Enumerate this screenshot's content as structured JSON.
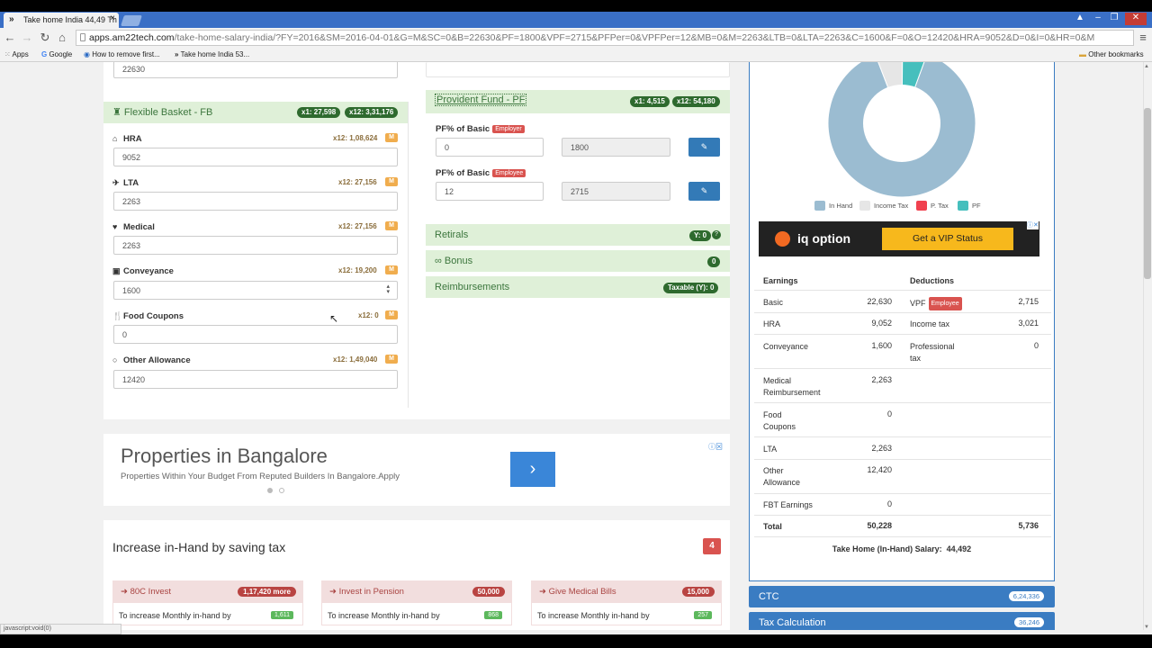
{
  "browser": {
    "tab_title": "Take home India 44,49 Th",
    "url_host": "apps.am22tech.com",
    "url_path": "/take-home-salary-india/?FY=2016&SM=2016-04-01&G=M&SC=0&B=22630&PF=1800&VPF=2715&PFPer=0&VPFPer=12&MB=0&M=2263&LTB=0&LTA=2263&C=1600&F=0&O=12420&HRA=9052&D=0&I=0&HR=0&M",
    "bookmarks": [
      "Apps",
      "Google",
      "How to remove first...",
      "Take home India 53..."
    ],
    "other_bookmarks": "Other bookmarks",
    "status_text": "javascript:void(0)"
  },
  "left_panel": {
    "top_value": "22630",
    "fb_title": "Flexible Basket - FB",
    "fb_x1": "x1: 27,598",
    "fb_x12": "x12: 3,31,176",
    "fields": [
      {
        "label": "HRA",
        "icon": "home-icon",
        "x12": "x12: 1,08,624",
        "value": "9052"
      },
      {
        "label": "LTA",
        "icon": "plane-icon",
        "x12": "x12: 27,156",
        "value": "2263"
      },
      {
        "label": "Medical",
        "icon": "heartbeat-icon",
        "x12": "x12: 27,156",
        "value": "2263"
      },
      {
        "label": "Conveyance",
        "icon": "bus-icon",
        "x12": "x12: 19,200",
        "value": "1600"
      },
      {
        "label": "Food Coupons",
        "icon": "cutlery-icon",
        "x12": "x12: 0",
        "value": "0"
      },
      {
        "label": "Other Allowance",
        "icon": "circle-icon",
        "x12": "x12: 1,49,040",
        "value": "12420"
      }
    ],
    "m_badge": "M"
  },
  "right_panel": {
    "pf_title": "Provident Fund - PF",
    "pf_x1": "x1: 4,515",
    "pf_x12": "x12: 54,180",
    "pf_rows": [
      {
        "label": "PF% of Basic",
        "badge": "Employer",
        "percent": "0",
        "amount": "1800"
      },
      {
        "label": "PF% of Basic",
        "badge": "Employee",
        "percent": "12",
        "amount": "2715"
      }
    ],
    "retirals": "Retirals",
    "retirals_badge": "Y: 0",
    "bonus": "Bonus",
    "bonus_badge": "0",
    "reimbursements": "Reimbursements",
    "reimb_badge": "Taxable (Y): 0"
  },
  "ad": {
    "title": "Properties in Bangalore",
    "subtitle": "Properties Within Your Budget From Reputed Builders In Bangalore.Apply"
  },
  "tax_section": {
    "title": "Increase in-Hand by saving tax",
    "count": "4",
    "tips": [
      {
        "title": "80C Invest",
        "badge": "1,17,420 more",
        "text": "To increase Monthly in-hand by",
        "value": "1,611"
      },
      {
        "title": "Invest in Pension",
        "badge": "50,000",
        "text": "To increase Monthly in-hand by",
        "value": "868"
      },
      {
        "title": "Give Medical Bills",
        "badge": "15,000",
        "text": "To increase Monthly in-hand by",
        "value": "257"
      }
    ]
  },
  "sidebar": {
    "legend": [
      {
        "label": "In Hand",
        "color": "#9bbcd1"
      },
      {
        "label": "Income Tax",
        "color": "#e6e6e6"
      },
      {
        "label": "P. Tax",
        "color": "#f0414f"
      },
      {
        "label": "PF",
        "color": "#46bfbd"
      }
    ],
    "donut": {
      "in_hand": 44492,
      "income_tax": 3021,
      "p_tax": 0,
      "pf": 2715
    },
    "iq_ad": {
      "brand": "iq option",
      "cta": "Get a VIP Status"
    },
    "earnings_header": "Earnings",
    "deductions_header": "Deductions",
    "earnings": [
      {
        "label": "Basic",
        "value": "22,630"
      },
      {
        "label": "HRA",
        "value": "9,052"
      },
      {
        "label": "Conveyance",
        "value": "1,600"
      },
      {
        "label": "Medical Reimbursement",
        "value": "2,263"
      },
      {
        "label": "Food Coupons",
        "value": "0"
      },
      {
        "label": "LTA",
        "value": "2,263"
      },
      {
        "label": "Other Allowance",
        "value": "12,420"
      },
      {
        "label": "FBT Earnings",
        "value": "0"
      }
    ],
    "deductions": [
      {
        "label": "VPF",
        "badge": "Employee",
        "value": "2,715"
      },
      {
        "label": "Income tax",
        "value": "3,021"
      },
      {
        "label": "Professional tax",
        "value": "0"
      }
    ],
    "total_label": "Total",
    "total_earnings": "50,228",
    "total_deductions": "5,736",
    "take_home": "Take Home (In-Hand) Salary:  44,492",
    "ctc": "CTC",
    "ctc_value": "6,24,336",
    "tax_calc": "Tax Calculation",
    "tax_calc_value": "36,246"
  }
}
